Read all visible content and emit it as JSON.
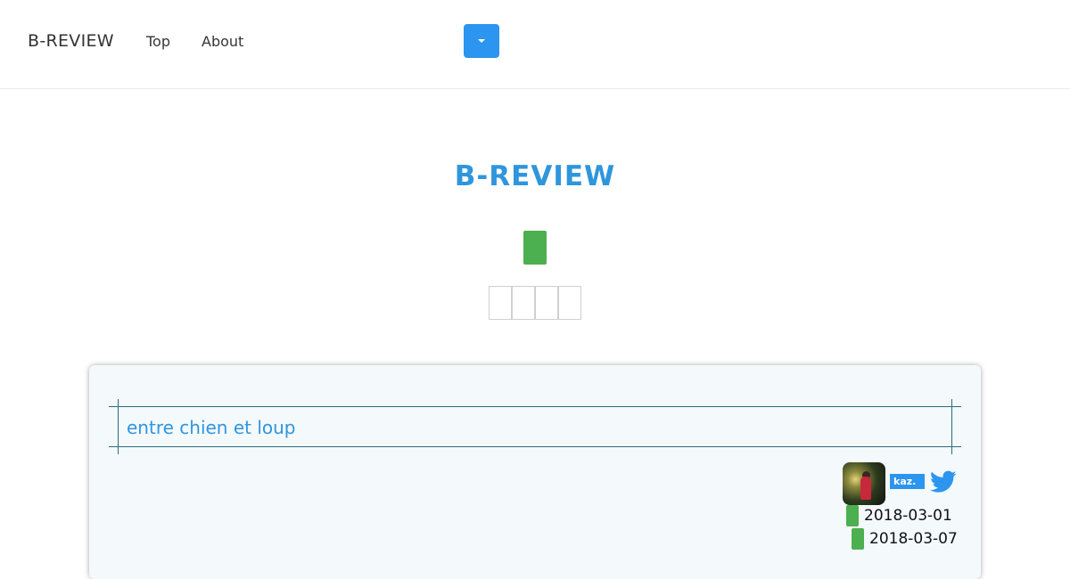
{
  "nav": {
    "brand": "B-REVIEW",
    "links": [
      {
        "label": "Top"
      },
      {
        "label": "About"
      }
    ],
    "dropdown_color": "#2b95f0"
  },
  "hero": {
    "title": "B-REVIEW",
    "title_color": "#2f96dc",
    "accent_color": "#4caf50"
  },
  "card": {
    "title": "entre chien et loup",
    "author_badge": "kaz.",
    "share_icon": "twitter-icon",
    "dates": [
      "2018-03-01",
      "2018-03-07"
    ]
  }
}
